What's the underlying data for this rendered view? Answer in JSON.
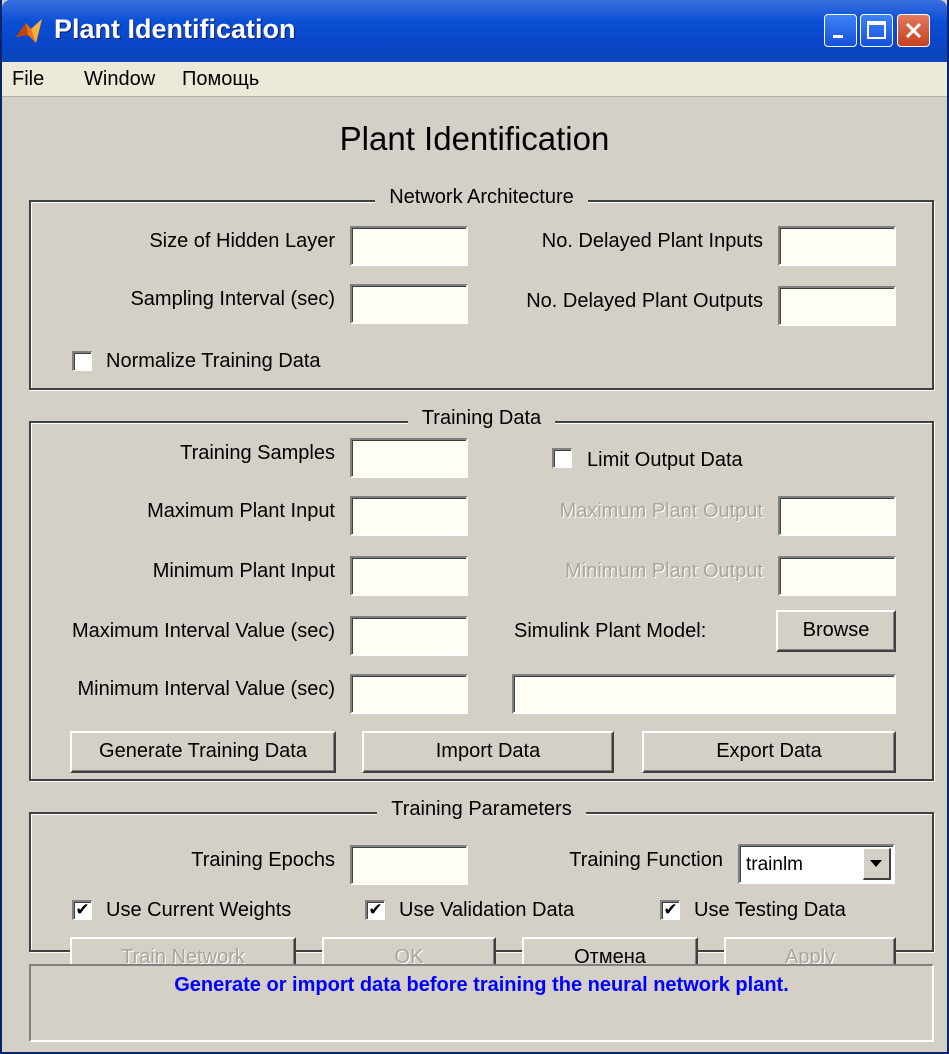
{
  "window": {
    "title": "Plant Identification"
  },
  "menu": {
    "file": "File",
    "window": "Window",
    "help": "Помощь"
  },
  "main_title": "Plant Identification",
  "network_architecture": {
    "title": "Network Architecture",
    "hidden_layer_label": "Size of Hidden Layer",
    "hidden_layer_value": "",
    "sampling_interval_label": "Sampling Interval (sec)",
    "sampling_interval_value": "",
    "delayed_inputs_label": "No. Delayed Plant Inputs",
    "delayed_inputs_value": "",
    "delayed_outputs_label": "No. Delayed Plant Outputs",
    "delayed_outputs_value": "",
    "normalize_label": "Normalize Training Data",
    "normalize_checked": false
  },
  "training_data": {
    "title": "Training Data",
    "samples_label": "Training Samples",
    "samples_value": "",
    "max_input_label": "Maximum Plant Input",
    "max_input_value": "",
    "min_input_label": "Minimum Plant Input",
    "min_input_value": "",
    "max_interval_label": "Maximum Interval Value (sec)",
    "max_interval_value": "",
    "min_interval_label": "Minimum Interval Value (sec)",
    "min_interval_value": "",
    "limit_output_label": "Limit Output Data",
    "limit_output_checked": false,
    "max_output_label": "Maximum Plant Output",
    "max_output_value": "",
    "min_output_label": "Minimum Plant Output",
    "min_output_value": "",
    "simulink_label": "Simulink Plant Model:",
    "browse_label": "Browse",
    "simulink_model_value": "",
    "generate_label": "Generate Training Data",
    "import_label": "Import Data",
    "export_label": "Export Data"
  },
  "training_parameters": {
    "title": "Training Parameters",
    "epochs_label": "Training Epochs",
    "epochs_value": "",
    "function_label": "Training Function",
    "function_value": "trainlm",
    "current_weights_label": "Use Current Weights",
    "current_weights_checked": true,
    "validation_label": "Use Validation Data",
    "validation_checked": true,
    "testing_label": "Use Testing Data",
    "testing_checked": true,
    "train_label": "Train Network",
    "ok_label": "OK",
    "cancel_label": "Отмена",
    "apply_label": "Apply"
  },
  "status": {
    "message": "Generate or import data before training the neural network plant."
  },
  "glyphs": {
    "check": "✔"
  }
}
